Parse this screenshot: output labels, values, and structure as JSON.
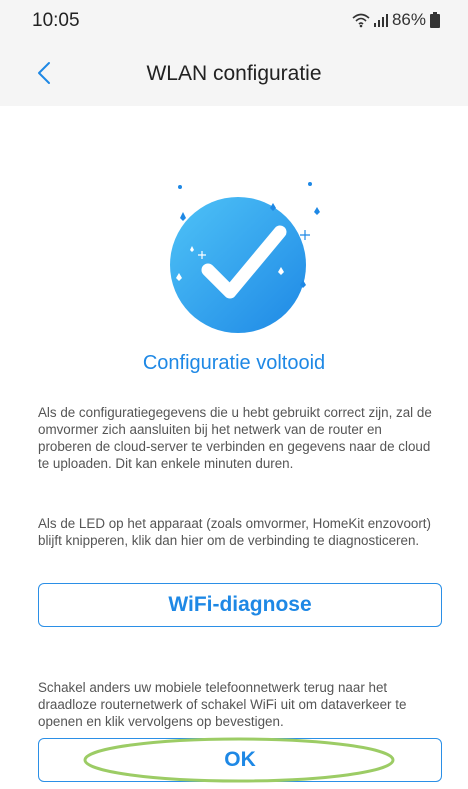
{
  "status_bar": {
    "time": "10:05",
    "battery": "86%"
  },
  "header": {
    "title": "WLAN configuratie"
  },
  "main": {
    "heading": "Configuratie voltooid",
    "paragraph_1": "Als de configuratiegegevens die u hebt gebruikt correct zijn, zal de omvormer zich aansluiten bij het netwerk van de router en proberen de cloud-server te verbinden en gegevens naar de cloud te uploaden. Dit kan enkele minuten duren.",
    "paragraph_2": "Als de LED op het apparaat (zoals omvormer, HomeKit enzovoort) blijft knipperen, klik dan hier om de verbinding te diagnosticeren.",
    "diagnose_button": "WiFi-diagnose",
    "paragraph_3": "Schakel anders uw mobiele telefoonnetwerk terug naar het draadloze routernetwerk of schakel WiFi uit om dataverkeer te openen en klik vervolgens op bevestigen.",
    "ok_button": "OK"
  },
  "colors": {
    "accent": "#1e88e5",
    "highlight_ellipse": "#9ccc65"
  },
  "icons": {
    "back": "chevron-left-icon",
    "wifi": "wifi-icon",
    "signal": "signal-icon",
    "battery": "battery-icon",
    "hero": "check-circle-icon"
  }
}
